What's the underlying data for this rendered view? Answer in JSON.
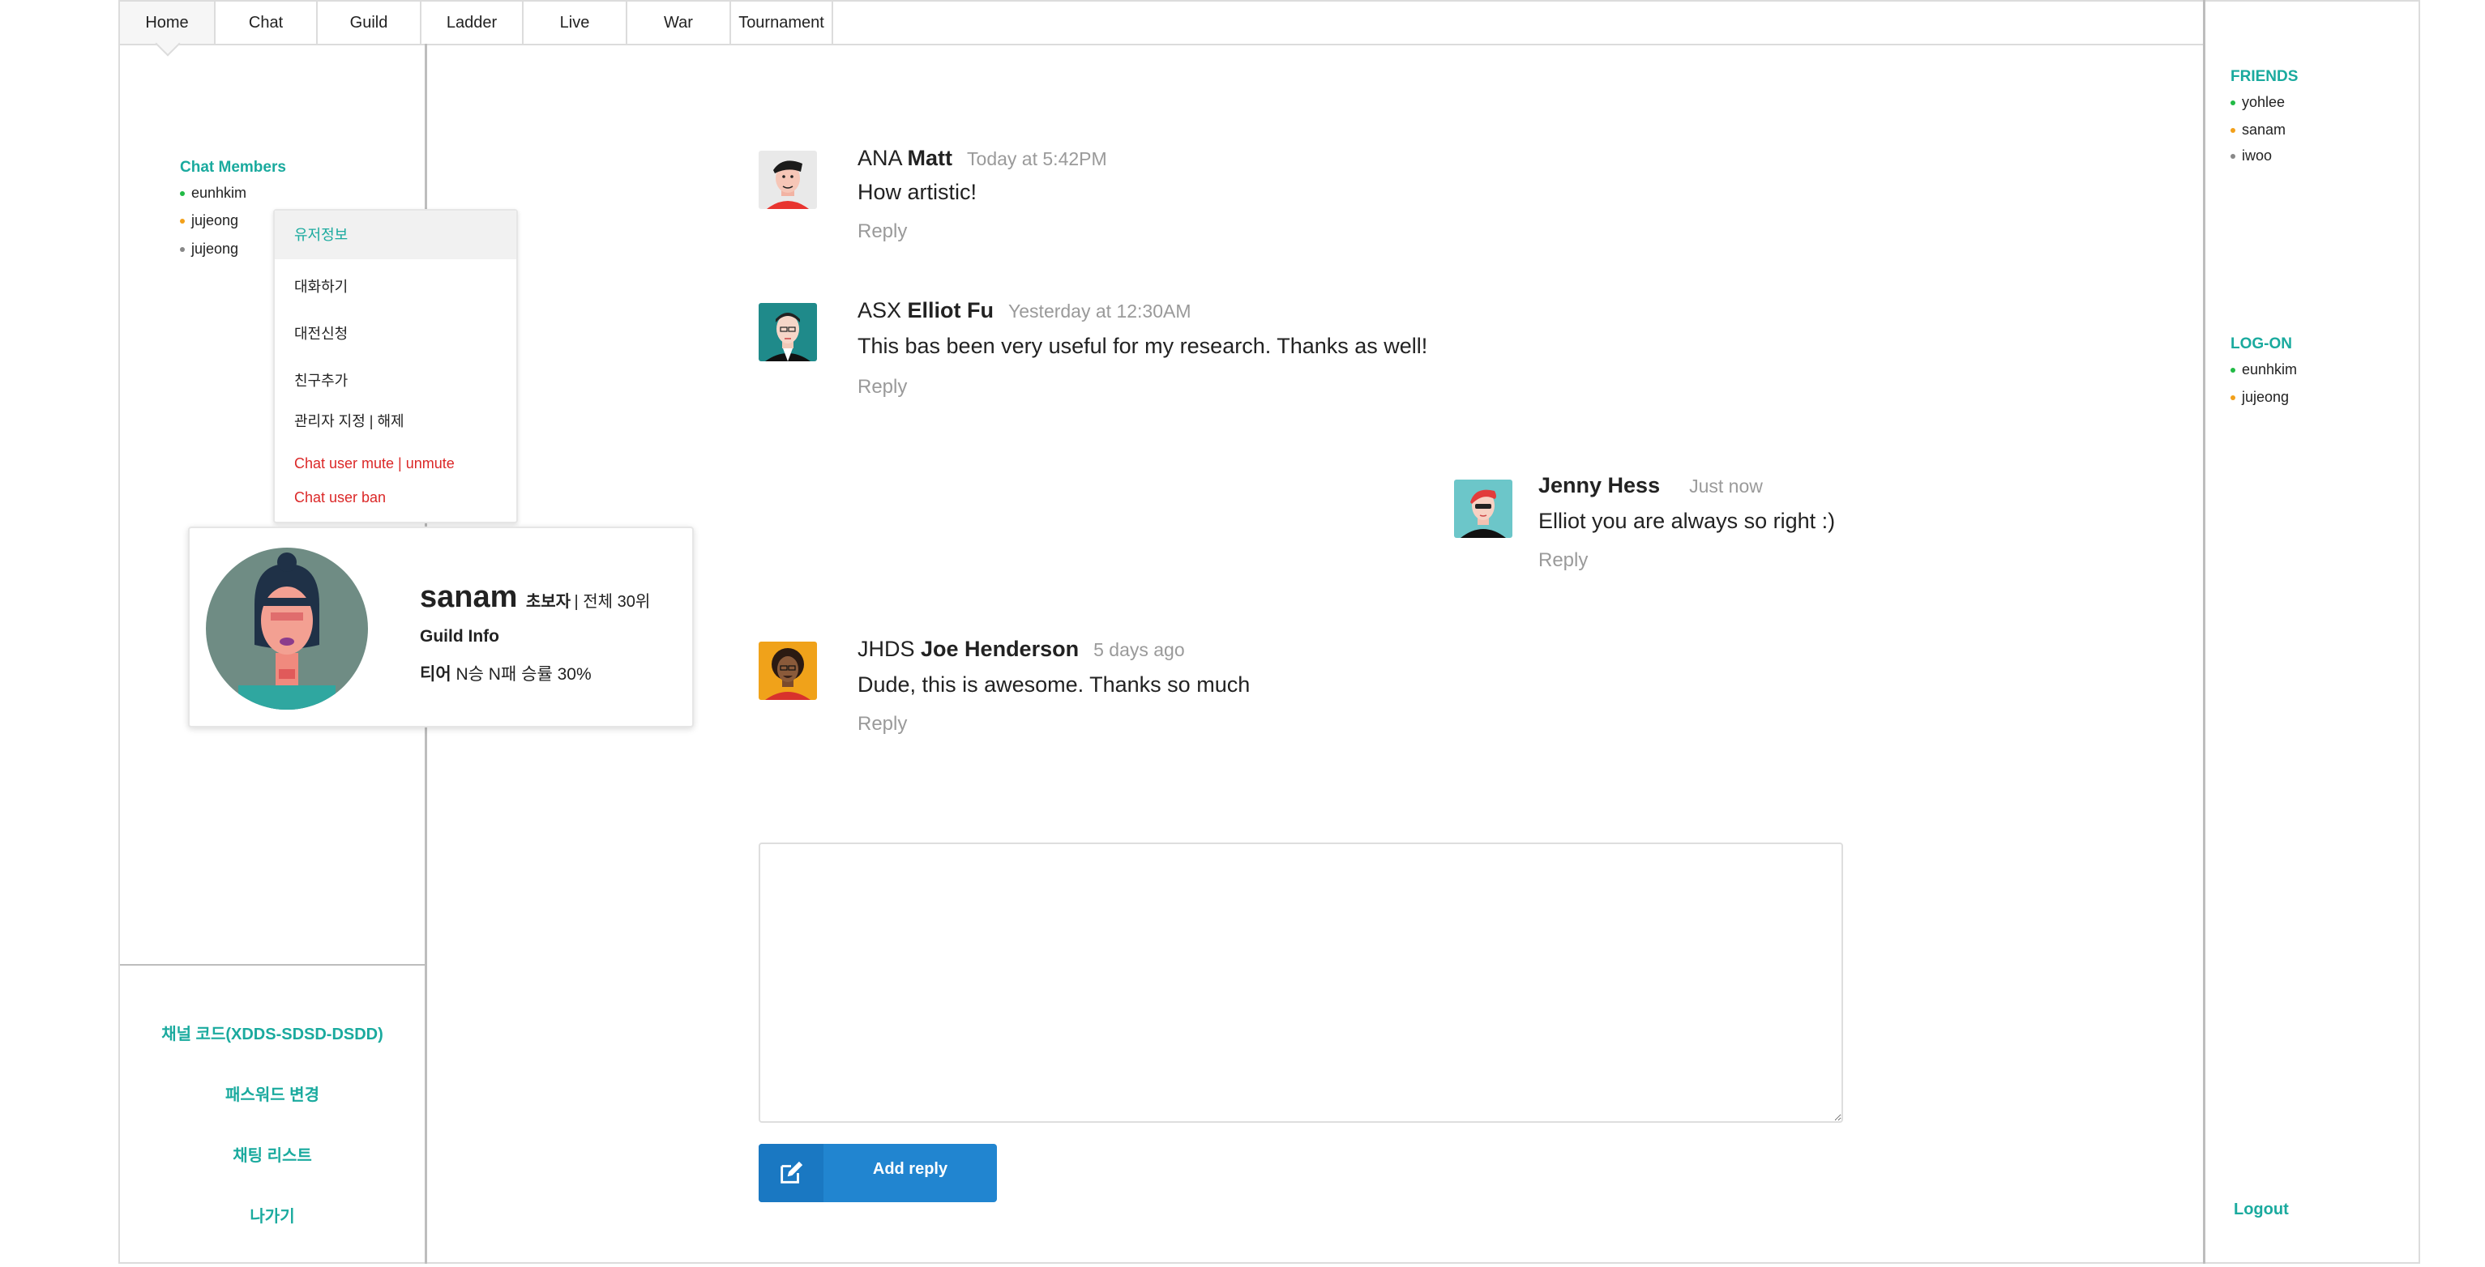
{
  "nav": {
    "tabs": [
      "Home",
      "Chat",
      "Guild",
      "Ladder",
      "Live",
      "War",
      "Tournament"
    ]
  },
  "left_panel": {
    "title": "Chat Members",
    "members": [
      {
        "name": "eunhkim",
        "status": "green"
      },
      {
        "name": "jujeong",
        "status": "orange"
      },
      {
        "name": "jujeong",
        "status": "gray"
      }
    ],
    "bottom_links": [
      "채널 코드(XDDS-SDSD-DSDD)",
      "패스워드 변경",
      "채팅 리스트",
      "나가기"
    ]
  },
  "context_menu": {
    "items": [
      "유저정보",
      "대화하기",
      "대전신청",
      "친구추가",
      "관리자 지정 | 해제"
    ],
    "danger_items": [
      "Chat user mute | unmute",
      "Chat user ban"
    ]
  },
  "profile_card": {
    "username": "sanam",
    "rank_label": "초보자",
    "rank_detail": "| 전체 30위",
    "guild_info": "Guild Info",
    "tier_label": "티어",
    "record": "N승 N패 승률 30%"
  },
  "messages": [
    {
      "tag": "ANA",
      "name": "Matt",
      "time": "Today at 5:42PM",
      "text": "How artistic!",
      "reply": "Reply"
    },
    {
      "tag": "ASX",
      "name": "Elliot Fu",
      "time": "Yesterday at 12:30AM",
      "text": "This bas been very useful for my research. Thanks as well!",
      "reply": "Reply"
    },
    {
      "tag": "",
      "name": "Jenny Hess",
      "time": "Just now",
      "text": "Elliot you are always so right :)",
      "reply": "Reply"
    },
    {
      "tag": "JHDS",
      "name": "Joe Henderson",
      "time": "5 days ago",
      "text": "Dude, this is awesome. Thanks so much",
      "reply": "Reply"
    }
  ],
  "composer": {
    "button_label": "Add reply"
  },
  "right_panel": {
    "friends_title": "FRIENDS",
    "friends": [
      {
        "name": "yohlee",
        "status": "green"
      },
      {
        "name": "sanam",
        "status": "orange"
      },
      {
        "name": "iwoo",
        "status": "gray"
      }
    ],
    "logon_title": "LOG-ON",
    "logon": [
      {
        "name": "eunhkim",
        "status": "green"
      },
      {
        "name": "jujeong",
        "status": "orange"
      }
    ],
    "logout": "Logout"
  },
  "colors": {
    "accent": "#1aaa9e",
    "danger": "#db2828",
    "button": "#2185d0"
  }
}
